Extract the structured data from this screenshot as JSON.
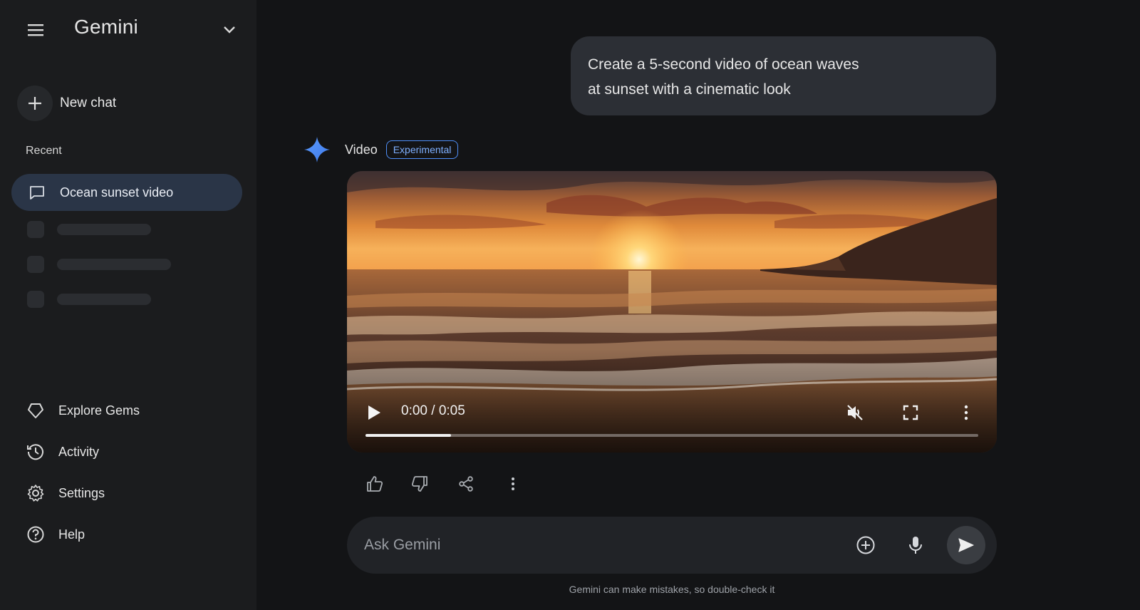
{
  "app": {
    "brand": "Gemini"
  },
  "sidebar": {
    "new_chat_label": "New chat",
    "recent_heading": "Recent",
    "recent_items": [
      {
        "label": "Ocean sunset video",
        "icon": "chat-bubble-icon",
        "selected": true
      }
    ],
    "nav": [
      {
        "label": "Explore Gems",
        "icon": "gem-icon"
      },
      {
        "label": "Activity",
        "icon": "history-icon"
      },
      {
        "label": "Settings",
        "icon": "gear-icon"
      },
      {
        "label": "Help",
        "icon": "help-icon"
      }
    ]
  },
  "conversation": {
    "user_message_lines": [
      "Create a 5-second video of ocean waves",
      "at sunset with a cinematic look"
    ],
    "response": {
      "title": "Video",
      "badge": "Experimental",
      "video": {
        "time_display": "0:00 / 0:05",
        "progress_fraction": 0.14,
        "muted": true
      }
    }
  },
  "composer": {
    "placeholder": "Ask Gemini",
    "disclaimer": "Gemini can make mistakes, so double-check it"
  },
  "colors": {
    "accent": "#4f8ff7",
    "selected_item": "#2a3547",
    "background": "#131416",
    "sidebar": "#1b1c1e"
  }
}
